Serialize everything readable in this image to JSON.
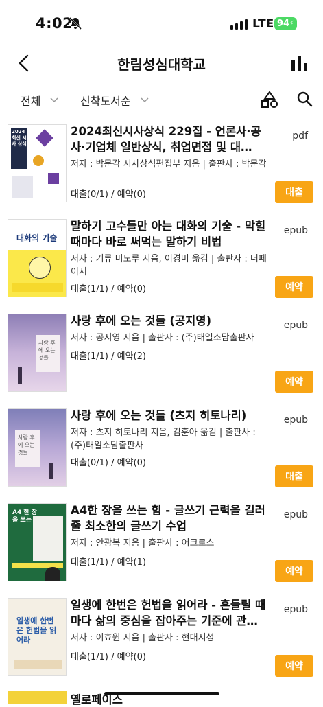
{
  "status_bar": {
    "time": "4:02",
    "network": "LTE",
    "battery": "94"
  },
  "header": {
    "title": "한림성심대학교"
  },
  "filters": {
    "category": "전체",
    "sort": "신착도서순"
  },
  "books": [
    {
      "title": "2024최신시사상식 229집 - 언론사·공사·기업체 일반상식, 취업면접 및 대…",
      "meta": "저자 : 박문각 시사상식편집부 지음 | 출판사 : 박문각",
      "status": "대출(0/1) / 예약(0)",
      "format": "pdf",
      "action": "대출",
      "cover_text": "2024 최신 시사 상식"
    },
    {
      "title": "말하기 고수들만 아는 대화의 기술 - 막힐 때마다 바로 써먹는 말하기 비법",
      "meta": "저자 : 기류 미노루 지음, 이경미 옮김 | 출판사 : 더페이지",
      "status": "대출(1/1) / 예약(0)",
      "format": "epub",
      "action": "예약",
      "cover_text": "대화의 기술"
    },
    {
      "title": "사랑 후에 오는 것들 (공지영)",
      "meta": "저자 : 공지영 지음 | 출판사 : (주)태일소담출판사",
      "status": "대출(1/1) / 예약(2)",
      "format": "epub",
      "action": "예약",
      "cover_text": "사랑 후에 오는 것들"
    },
    {
      "title": "사랑 후에 오는 것들 (츠지 히토나리)",
      "meta": "저자 : 츠지 히토나리 지음, 김훈아 옮김 | 출판사 : (주)태일소담출판사",
      "status": "대출(0/1) / 예약(0)",
      "format": "epub",
      "action": "대출",
      "cover_text": "사랑 후에 오는 것들"
    },
    {
      "title": "A4한 장을 쓰는 힘 - 글쓰기 근력을 길러줄 최소한의 글쓰기 수업",
      "meta": "저자 : 안광복 지음 | 출판사 : 어크로스",
      "status": "대출(1/1) / 예약(1)",
      "format": "epub",
      "action": "예약",
      "cover_text": "A4 한 장을 쓰는 힘"
    },
    {
      "title": "일생에 한번은 헌법을 읽어라 - 흔들릴 때마다 삶의 중심을 잡아주는 기준에 관…",
      "meta": "저자 : 이효원 지음 | 출판사 : 현대지성",
      "status": "대출(1/1) / 예약(0)",
      "format": "epub",
      "action": "예약",
      "cover_text": "일생에 한번은 헌법을 읽어라"
    }
  ],
  "partial_item": {
    "title": "옐로페이스"
  },
  "colors": {
    "accent": "#f8a515",
    "battery": "#4cd964"
  }
}
